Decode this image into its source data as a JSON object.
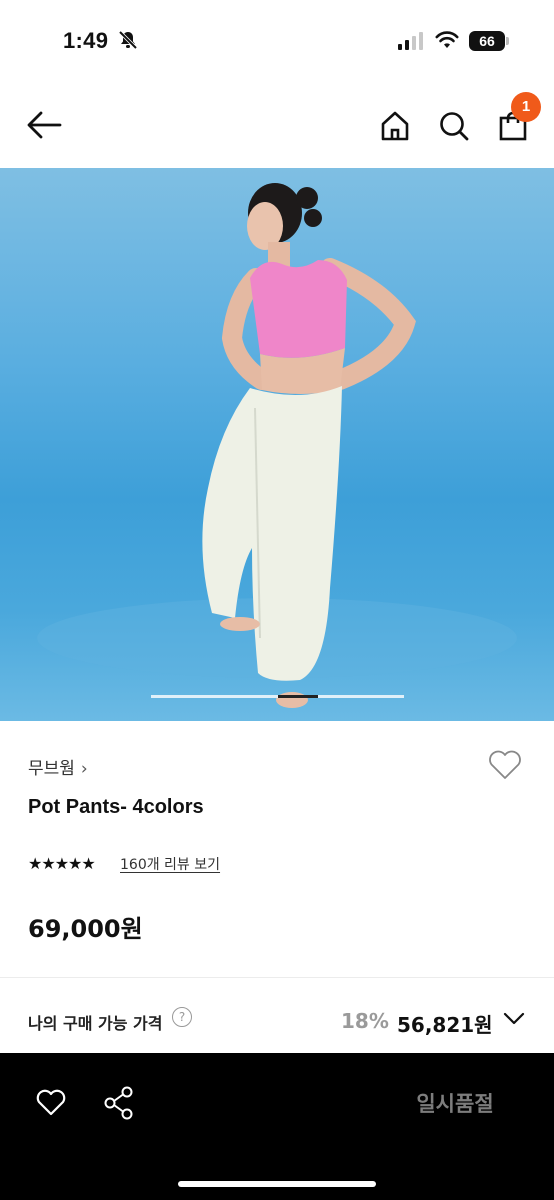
{
  "status_bar": {
    "time": "1:49",
    "battery": "66"
  },
  "header": {
    "cart_count": "1"
  },
  "gallery": {
    "current_slide_fraction": 0.66
  },
  "product": {
    "brand": "무브웜",
    "brand_chevron": "›",
    "title": "Pot Pants- 4colors",
    "rating_stars": "★★★★★",
    "review_link": "160개 리뷰 보기",
    "price": "69,000원"
  },
  "my_price": {
    "label": "나의 구매 가능 가격",
    "help": "?",
    "discount": "18%",
    "price": "56,821원"
  },
  "bottom_bar": {
    "action_label": "일시품절"
  },
  "icons": {
    "back": "arrow-left-icon",
    "home": "home-icon",
    "search": "search-icon",
    "cart": "shopping-bag-icon",
    "wish": "heart-icon",
    "share": "share-icon",
    "expand": "chevron-down-icon",
    "mute": "bell-slash-icon"
  },
  "colors": {
    "badge": "#f05a1a",
    "bottom_bar": "#000000",
    "discount": "#9a9a9a"
  }
}
